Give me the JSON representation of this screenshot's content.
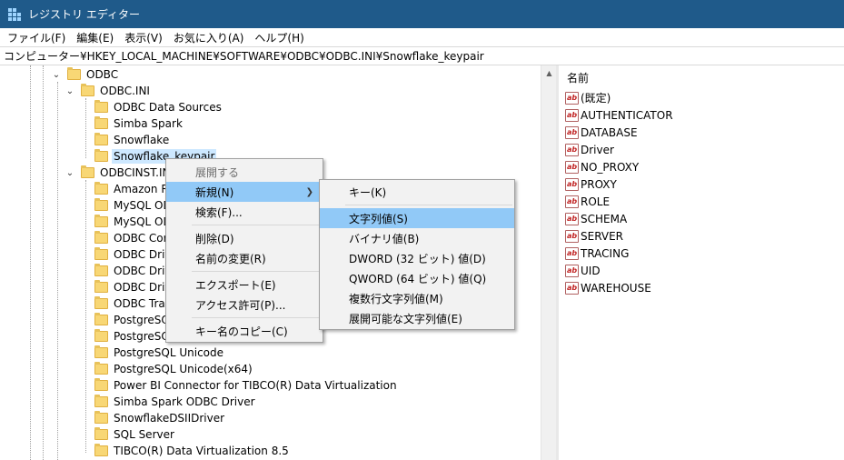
{
  "titlebar": {
    "title": "レジストリ エディター"
  },
  "menubar": {
    "items": [
      "ファイル(F)",
      "編集(E)",
      "表示(V)",
      "お気に入り(A)",
      "ヘルプ(H)"
    ]
  },
  "address": {
    "path": "コンピューター¥HKEY_LOCAL_MACHINE¥SOFTWARE¥ODBC¥ODBC.INI¥Snowflake_keypair"
  },
  "tree": {
    "odbc": "ODBC",
    "odbc_ini": "ODBC.INI",
    "odbc_ini_children": [
      "ODBC Data Sources",
      "Simba Spark",
      "Snowflake",
      "Snowflake_keypair"
    ],
    "odbcinst_ini": "ODBCINST.INI",
    "odbcinst_children": [
      "Amazon Re",
      "MySQL OD",
      "MySQL OD",
      "ODBC Core",
      "ODBC Drive",
      "ODBC Drive",
      "ODBC Drive",
      "ODBC Trans",
      "PostgreSQL",
      "PostgreSQL",
      "PostgreSQL Unicode",
      "PostgreSQL Unicode(x64)",
      "Power BI Connector for TIBCO(R) Data Virtualization",
      "Simba Spark ODBC Driver",
      "SnowflakeDSIIDriver",
      "SQL Server",
      "TIBCO(R) Data Virtualization 8.5"
    ]
  },
  "values": {
    "header_name": "名前",
    "rows": [
      "(既定)",
      "AUTHENTICATOR",
      "DATABASE",
      "Driver",
      "NO_PROXY",
      "PROXY",
      "ROLE",
      "SCHEMA",
      "SERVER",
      "TRACING",
      "UID",
      "WAREHOUSE"
    ],
    "icon": "ab-string-icon"
  },
  "context_menu": {
    "expand": "展開する",
    "new": "新規(N)",
    "find": "検索(F)...",
    "delete": "削除(D)",
    "rename": "名前の変更(R)",
    "export": "エクスポート(E)",
    "permissions": "アクセス許可(P)...",
    "copy_key_name": "キー名のコピー(C)"
  },
  "submenu": {
    "key": "キー(K)",
    "string": "文字列値(S)",
    "binary": "バイナリ値(B)",
    "dword": "DWORD (32 ビット) 値(D)",
    "qword": "QWORD (64 ビット) 値(Q)",
    "multi_string": "複数行文字列値(M)",
    "expandable_string": "展開可能な文字列値(E)"
  },
  "colors": {
    "titlebar": "#1f5a8a",
    "highlight": "#91c9f7",
    "selection": "#cde8ff"
  }
}
